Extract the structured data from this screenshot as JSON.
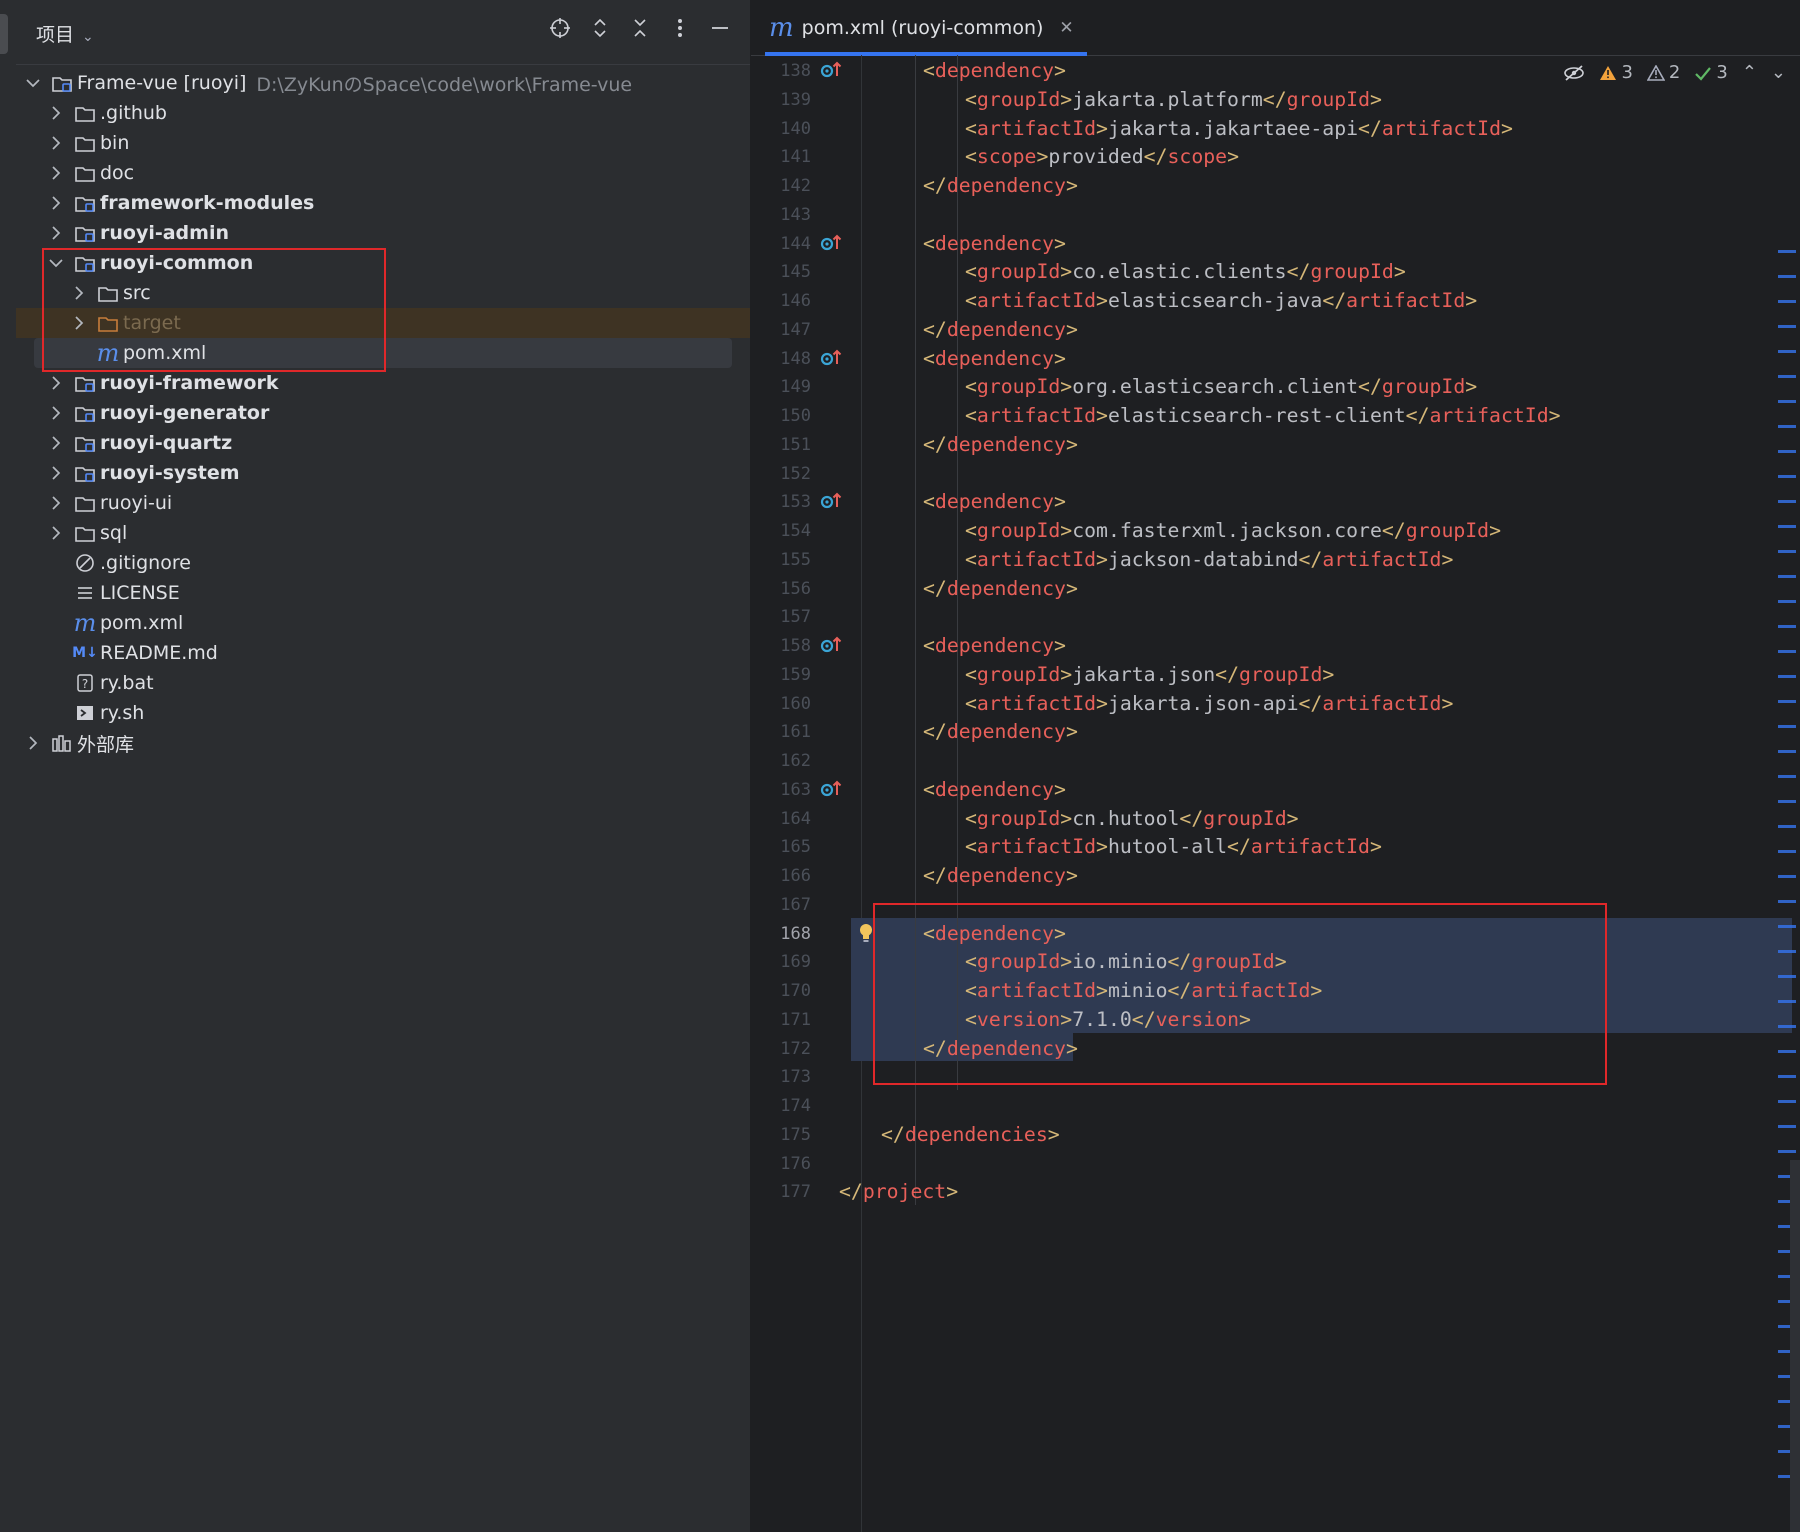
{
  "project_panel": {
    "title": "项目",
    "tree": [
      {
        "label": "Frame-vue [ruoyi]",
        "path": "D:\\ZyKunのSpace\\code\\work\\Frame-vue",
        "icon": "module-folder-icon",
        "expanded": true,
        "level": 0
      },
      {
        "label": ".github",
        "icon": "folder-icon",
        "level": 1
      },
      {
        "label": "bin",
        "icon": "folder-icon",
        "level": 1
      },
      {
        "label": "doc",
        "icon": "folder-icon",
        "level": 1
      },
      {
        "label": "framework-modules",
        "icon": "module-folder-icon",
        "level": 1,
        "bold": true
      },
      {
        "label": "ruoyi-admin",
        "icon": "module-folder-icon",
        "level": 1,
        "bold": true
      },
      {
        "label": "ruoyi-common",
        "icon": "module-folder-icon",
        "level": 1,
        "bold": true,
        "expanded": true
      },
      {
        "label": "src",
        "icon": "folder-icon",
        "level": 2
      },
      {
        "label": "target",
        "icon": "excluded-folder-icon",
        "level": 2,
        "excluded": true
      },
      {
        "label": "pom.xml",
        "icon": "maven-icon",
        "level": 2,
        "leaf": true,
        "selected": true
      },
      {
        "label": "ruoyi-framework",
        "icon": "module-folder-icon",
        "level": 1,
        "bold": true
      },
      {
        "label": "ruoyi-generator",
        "icon": "module-folder-icon",
        "level": 1,
        "bold": true
      },
      {
        "label": "ruoyi-quartz",
        "icon": "module-folder-icon",
        "level": 1,
        "bold": true
      },
      {
        "label": "ruoyi-system",
        "icon": "module-folder-icon",
        "level": 1,
        "bold": true
      },
      {
        "label": "ruoyi-ui",
        "icon": "folder-icon",
        "level": 1
      },
      {
        "label": "sql",
        "icon": "folder-icon",
        "level": 1
      },
      {
        "label": ".gitignore",
        "icon": "ignore-icon",
        "level": 1,
        "leaf": true
      },
      {
        "label": "LICENSE",
        "icon": "text-file-icon",
        "level": 1,
        "leaf": true
      },
      {
        "label": "pom.xml",
        "icon": "maven-icon",
        "level": 1,
        "leaf": true
      },
      {
        "label": "README.md",
        "icon": "markdown-icon",
        "level": 1,
        "leaf": true
      },
      {
        "label": "ry.bat",
        "icon": "unknown-file-icon",
        "level": 1,
        "leaf": true
      },
      {
        "label": "ry.sh",
        "icon": "shell-script-icon",
        "level": 1,
        "leaf": true
      },
      {
        "label": "外部库",
        "icon": "library-icon",
        "level": 0
      }
    ]
  },
  "editor": {
    "tab_label": "pom.xml (ruoyi-common)",
    "inspections": {
      "warnings": "3",
      "weak_warnings": "2",
      "ok": "3"
    },
    "lines": [
      {
        "n": "138",
        "indent": 2,
        "open": "dependency",
        "gutter": true
      },
      {
        "n": "139",
        "indent": 3,
        "tag": "groupId",
        "value": "jakarta.platform"
      },
      {
        "n": "140",
        "indent": 3,
        "tag": "artifactId",
        "value": "jakarta.jakartaee-api"
      },
      {
        "n": "141",
        "indent": 3,
        "tag": "scope",
        "value": "provided"
      },
      {
        "n": "142",
        "indent": 2,
        "close": "dependency"
      },
      {
        "n": "143"
      },
      {
        "n": "144",
        "indent": 2,
        "open": "dependency",
        "gutter": true
      },
      {
        "n": "145",
        "indent": 3,
        "tag": "groupId",
        "value": "co.elastic.clients"
      },
      {
        "n": "146",
        "indent": 3,
        "tag": "artifactId",
        "value": "elasticsearch-java"
      },
      {
        "n": "147",
        "indent": 2,
        "close": "dependency"
      },
      {
        "n": "148",
        "indent": 2,
        "open": "dependency",
        "gutter": true
      },
      {
        "n": "149",
        "indent": 3,
        "tag": "groupId",
        "value": "org.elasticsearch.client"
      },
      {
        "n": "150",
        "indent": 3,
        "tag": "artifactId",
        "value": "elasticsearch-rest-client"
      },
      {
        "n": "151",
        "indent": 2,
        "close": "dependency"
      },
      {
        "n": "152"
      },
      {
        "n": "153",
        "indent": 2,
        "open": "dependency",
        "gutter": true
      },
      {
        "n": "154",
        "indent": 3,
        "tag": "groupId",
        "value": "com.fasterxml.jackson.core"
      },
      {
        "n": "155",
        "indent": 3,
        "tag": "artifactId",
        "value": "jackson-databind"
      },
      {
        "n": "156",
        "indent": 2,
        "close": "dependency"
      },
      {
        "n": "157"
      },
      {
        "n": "158",
        "indent": 2,
        "open": "dependency",
        "gutter": true
      },
      {
        "n": "159",
        "indent": 3,
        "tag": "groupId",
        "value": "jakarta.json"
      },
      {
        "n": "160",
        "indent": 3,
        "tag": "artifactId",
        "value": "jakarta.json-api"
      },
      {
        "n": "161",
        "indent": 2,
        "close": "dependency"
      },
      {
        "n": "162"
      },
      {
        "n": "163",
        "indent": 2,
        "open": "dependency",
        "gutter": true
      },
      {
        "n": "164",
        "indent": 3,
        "tag": "groupId",
        "value": "cn.hutool"
      },
      {
        "n": "165",
        "indent": 3,
        "tag": "artifactId",
        "value": "hutool-all"
      },
      {
        "n": "166",
        "indent": 2,
        "close": "dependency"
      },
      {
        "n": "167"
      },
      {
        "n": "168",
        "indent": 2,
        "open": "dependency",
        "selected": true,
        "current": true,
        "bulb": true
      },
      {
        "n": "169",
        "indent": 3,
        "tag": "groupId",
        "value": "io.minio",
        "selected": true
      },
      {
        "n": "170",
        "indent": 3,
        "tag": "artifactId",
        "value": "minio",
        "selected": true
      },
      {
        "n": "171",
        "indent": 3,
        "tag": "version",
        "value": "7.1.0",
        "selected": true
      },
      {
        "n": "172",
        "indent": 2,
        "close": "dependency",
        "selected_partial": true
      },
      {
        "n": "173"
      },
      {
        "n": "174"
      },
      {
        "n": "175",
        "indent": 1,
        "close": "dependencies"
      },
      {
        "n": "176"
      },
      {
        "n": "177",
        "indent": 0,
        "close": "project"
      }
    ]
  },
  "colors": {
    "tag": "#e8605a",
    "bracket": "#d5b778",
    "accent": "#3574f0",
    "highlight": "#e0282a"
  }
}
